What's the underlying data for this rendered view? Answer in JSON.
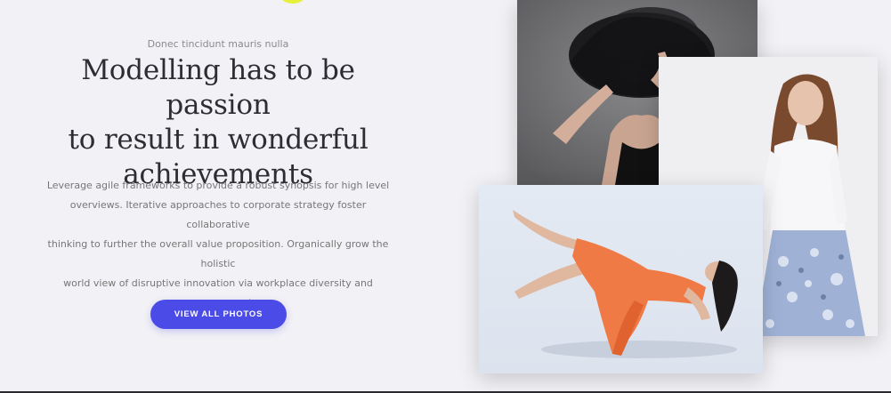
{
  "hero": {
    "eyebrow": "Donec tincidunt mauris nulla",
    "title_lines": [
      "Modelling has to be passion",
      "to result in wonderful",
      "achievements"
    ],
    "body_lines": [
      "Leverage agile frameworks to provide a robust synopsis for high level",
      "overviews. Iterative approaches to corporate strategy foster collaborative",
      "thinking to further the overall value proposition. Organically grow the holistic",
      "world view of disruptive innovation via workplace diversity and",
      "empowerment."
    ],
    "cta_label": "VIEW ALL PHOTOS"
  },
  "colors": {
    "background": "#f2f1f5",
    "accent": "#4b4be8",
    "highlight": "#e7f13a"
  },
  "gallery": {
    "photos": [
      {
        "subject": "model-black-tulle-hat"
      },
      {
        "subject": "model-white-blouse-floral-skirt"
      },
      {
        "subject": "model-orange-dress-floating"
      }
    ]
  }
}
